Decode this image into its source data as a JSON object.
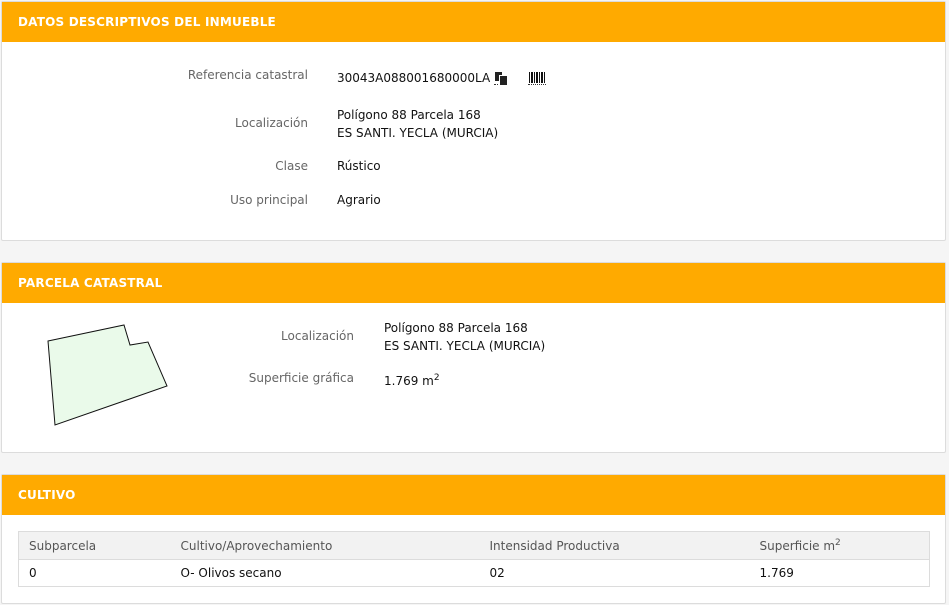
{
  "panel1": {
    "title": "DATOS DESCRIPTIVOS DEL INMUEBLE",
    "ref_label": "Referencia catastral",
    "ref_value": "30043A088001680000LA",
    "loc_label": "Localización",
    "loc_line1": "Polígono 88 Parcela 168",
    "loc_line2": "ES SANTI. YECLA (MURCIA)",
    "clase_label": "Clase",
    "clase_value": "Rústico",
    "uso_label": "Uso principal",
    "uso_value": "Agrario",
    "icons": [
      "copy-icon",
      "barcode-icon"
    ]
  },
  "panel2": {
    "title": "PARCELA CATASTRAL",
    "loc_label": "Localización",
    "loc_line1": "Polígono 88 Parcela 168",
    "loc_line2": "ES SANTI. YECLA (MURCIA)",
    "sup_label": "Superficie gráfica",
    "sup_value": "1.769 m",
    "sup_unit_exp": "2",
    "shape_fill": "#eafaea"
  },
  "panel3": {
    "title": "CULTIVO",
    "headers": [
      "Subparcela",
      "Cultivo/Aprovechamiento",
      "Intensidad Productiva",
      "Superficie m"
    ],
    "header_exp": "2",
    "rows": [
      [
        "0",
        "O- Olivos secano",
        "02",
        "1.769"
      ]
    ]
  },
  "colors": {
    "accent": "#ffaa00",
    "header_text": "#ffffff"
  }
}
